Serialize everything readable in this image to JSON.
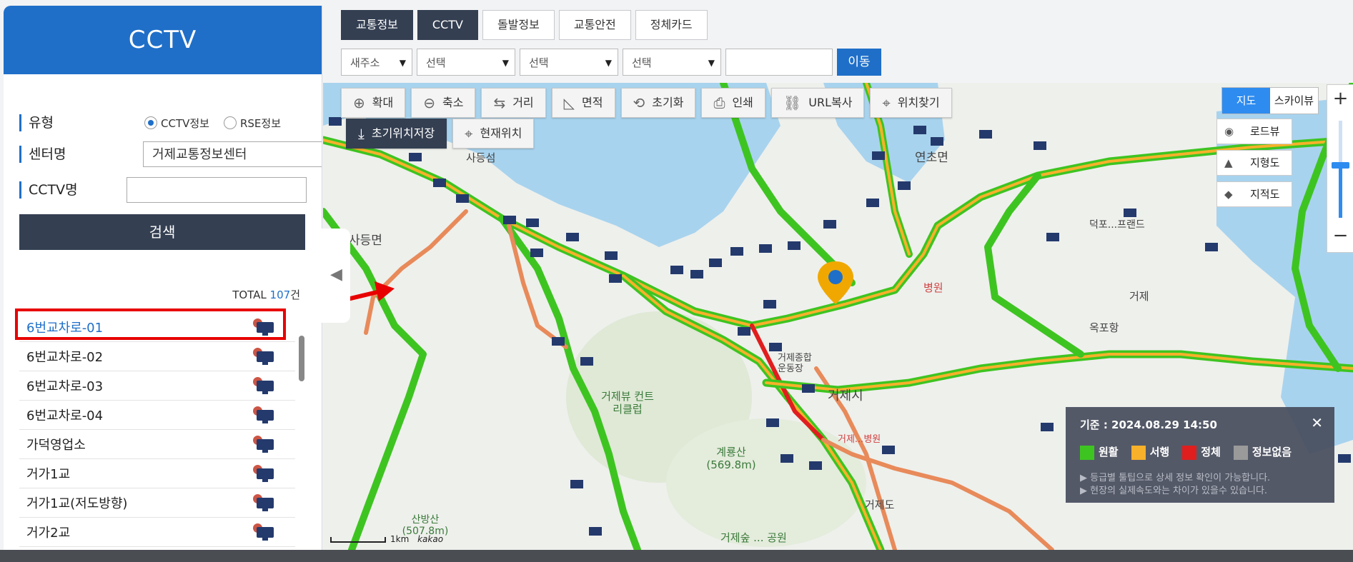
{
  "colors": {
    "accent": "#1f6fc8",
    "dark": "#343f52",
    "smooth": "#3ec421",
    "slow": "#f7b12a",
    "congested": "#e01e1e",
    "none": "#9a9a9a",
    "water": "#a8d3ee"
  },
  "left_panel": {
    "title": "CCTV",
    "type_label": "유형",
    "type_options": [
      "CCTV정보",
      "RSE정보"
    ],
    "type_selected": "CCTV정보",
    "center_label": "센터명",
    "center_value": "거제교통정보센터",
    "cctv_name_label": "CCTV명",
    "cctv_name_value": "",
    "search_button": "검색",
    "total_prefix": "TOTAL ",
    "total_count": "107",
    "total_suffix": "건",
    "items": [
      {
        "label": "6번교차로-01",
        "active": true,
        "icon": "cctv-camera-icon"
      },
      {
        "label": "6번교차로-02",
        "active": false,
        "icon": "cctv-camera-icon"
      },
      {
        "label": "6번교차로-03",
        "active": false,
        "icon": "cctv-camera-icon"
      },
      {
        "label": "6번교차로-04",
        "active": false,
        "icon": "cctv-camera-icon"
      },
      {
        "label": "가덕영업소",
        "active": false,
        "icon": "cctv-camera-icon"
      },
      {
        "label": "거가1교",
        "active": false,
        "icon": "cctv-camera-icon"
      },
      {
        "label": "거가1교(저도방향)",
        "active": false,
        "icon": "cctv-camera-icon"
      },
      {
        "label": "거가2교",
        "active": false,
        "icon": "cctv-camera-icon"
      }
    ]
  },
  "tabs": [
    "교통정보",
    "CCTV",
    "돌발정보",
    "교통안전",
    "정체카드"
  ],
  "active_tab": "CCTV",
  "filters": {
    "address_type": "새주소",
    "select1": "선택",
    "select2": "선택",
    "select3": "선택",
    "text": "",
    "go_button": "이동"
  },
  "toolbar": {
    "zoom_in": "확대",
    "zoom_out": "축소",
    "distance": "거리",
    "area": "면적",
    "reset": "초기화",
    "print": "인쇄",
    "url_copy": "URL복사",
    "find_location": "위치찾기",
    "save_initial": "초기위치저장",
    "current_location": "현재위치"
  },
  "map_controls": {
    "map": "지도",
    "skyview": "스카이뷰",
    "roadview": "로드뷰",
    "terrain": "지형도",
    "cadastral": "지적도",
    "zoom_plus": "+",
    "zoom_minus": "−",
    "zoom_level_fraction": 0.42
  },
  "map_labels": {
    "sadeung_island": "사등섬",
    "sadeung_myeon": "사등면",
    "yeoncho_myeon": "연초면",
    "hospital1": "병원",
    "geoje_city": "거제시",
    "geoje_center": "거제종합운동장",
    "country_club": "거제뷰 컨트리클럽",
    "gyeryongsan": "계룡산 (569.8m)",
    "sanbangsan": "산방산 (507.8m)",
    "geoje_dong": "거제도",
    "forest": "거제숲 ... 공원",
    "hospital2": "거제...병원",
    "okpo": "옥포항",
    "deokpo": "덕포...프랜드",
    "geoje_left_edge": "거",
    "geo_mid": "거제",
    "scale": "1km",
    "kakao": "kakao"
  },
  "legend": {
    "title": "기준 : 2024.08.29 14:50",
    "close_icon": "close-icon",
    "items": [
      {
        "label": "원활",
        "color": "#3ec421"
      },
      {
        "label": "서행",
        "color": "#f7b12a"
      },
      {
        "label": "정체",
        "color": "#e01e1e"
      },
      {
        "label": "정보없음",
        "color": "#9a9a9a"
      }
    ],
    "note1": "▶ 등급별 툴팁으로 상세 정보 확인이 가능합니다.",
    "note2": "▶ 현장의 실제속도와는 차이가 있을수 있습니다."
  }
}
